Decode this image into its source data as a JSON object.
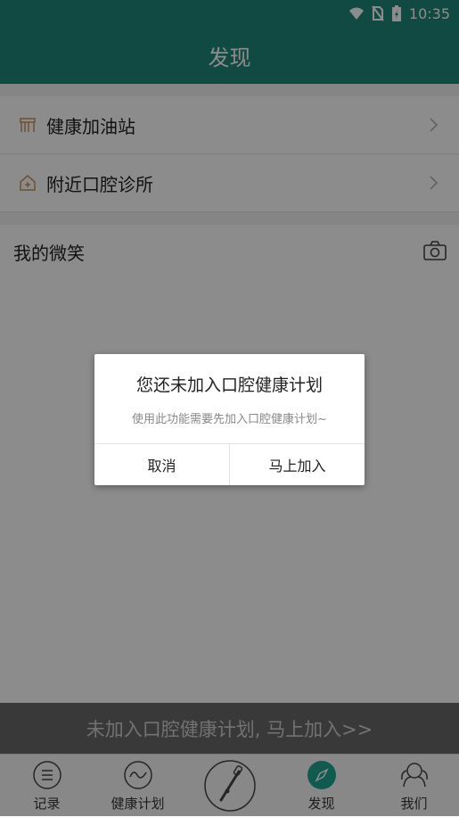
{
  "status": {
    "time": "10:35"
  },
  "appbar": {
    "title": "发现"
  },
  "menu": [
    {
      "label": "健康加油站",
      "icon": "store-icon"
    },
    {
      "label": "附近口腔诊所",
      "icon": "clinic-icon"
    }
  ],
  "smile": {
    "title": "我的微笑"
  },
  "banner": {
    "text": "未加入口腔健康计划, 马上加入>>"
  },
  "tabs": [
    {
      "label": "记录",
      "icon": "list-icon"
    },
    {
      "label": "健康计划",
      "icon": "wave-icon"
    },
    {
      "label": "",
      "icon": "toothbrush-icon"
    },
    {
      "label": "发现",
      "icon": "compass-icon"
    },
    {
      "label": "我们",
      "icon": "people-icon"
    }
  ],
  "dialog": {
    "title": "您还未加入口腔健康计划",
    "message": "使用此功能需要先加入口腔健康计划~",
    "cancel": "取消",
    "confirm": "马上加入"
  },
  "colors": {
    "primary": "#1f8878",
    "accent": "#1fa592"
  }
}
